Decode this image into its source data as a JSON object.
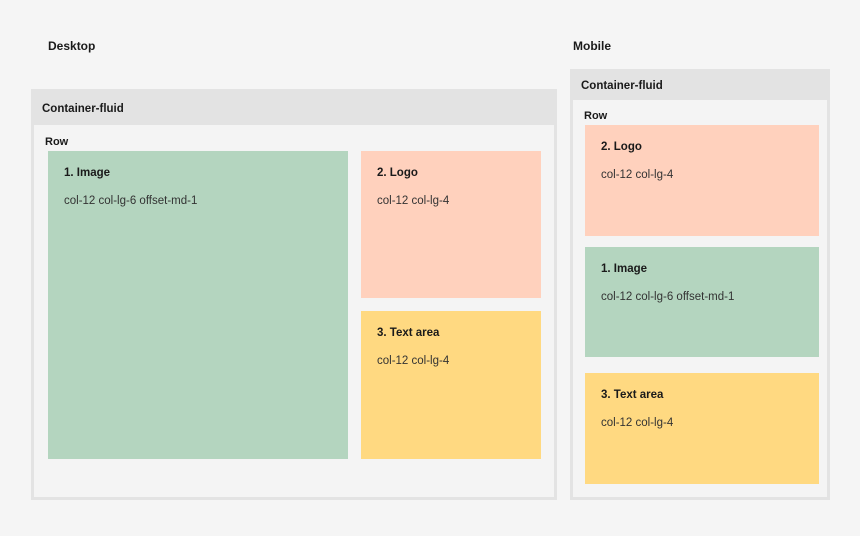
{
  "desktop": {
    "heading": "Desktop",
    "container_label": "Container-fluid",
    "row_label": "Row",
    "boxes": [
      {
        "title": "1. Image",
        "classes": "col-12 col-lg-6 offset-md-1",
        "color": "#b4d5bf"
      },
      {
        "title": "2. Logo",
        "classes": "col-12 col-lg-4",
        "color": "#ffd1bd"
      },
      {
        "title": "3. Text area",
        "classes": "col-12 col-lg-4",
        "color": "#ffd981"
      }
    ]
  },
  "mobile": {
    "heading": "Mobile",
    "container_label": "Container-fluid",
    "row_label": "Row",
    "boxes": [
      {
        "title": "2. Logo",
        "classes": "col-12 col-lg-4",
        "color": "#ffd1bd"
      },
      {
        "title": "1. Image",
        "classes": "col-12 col-lg-6 offset-md-1",
        "color": "#b4d5bf"
      },
      {
        "title": "3. Text area",
        "classes": "col-12 col-lg-4",
        "color": "#ffd981"
      }
    ]
  }
}
